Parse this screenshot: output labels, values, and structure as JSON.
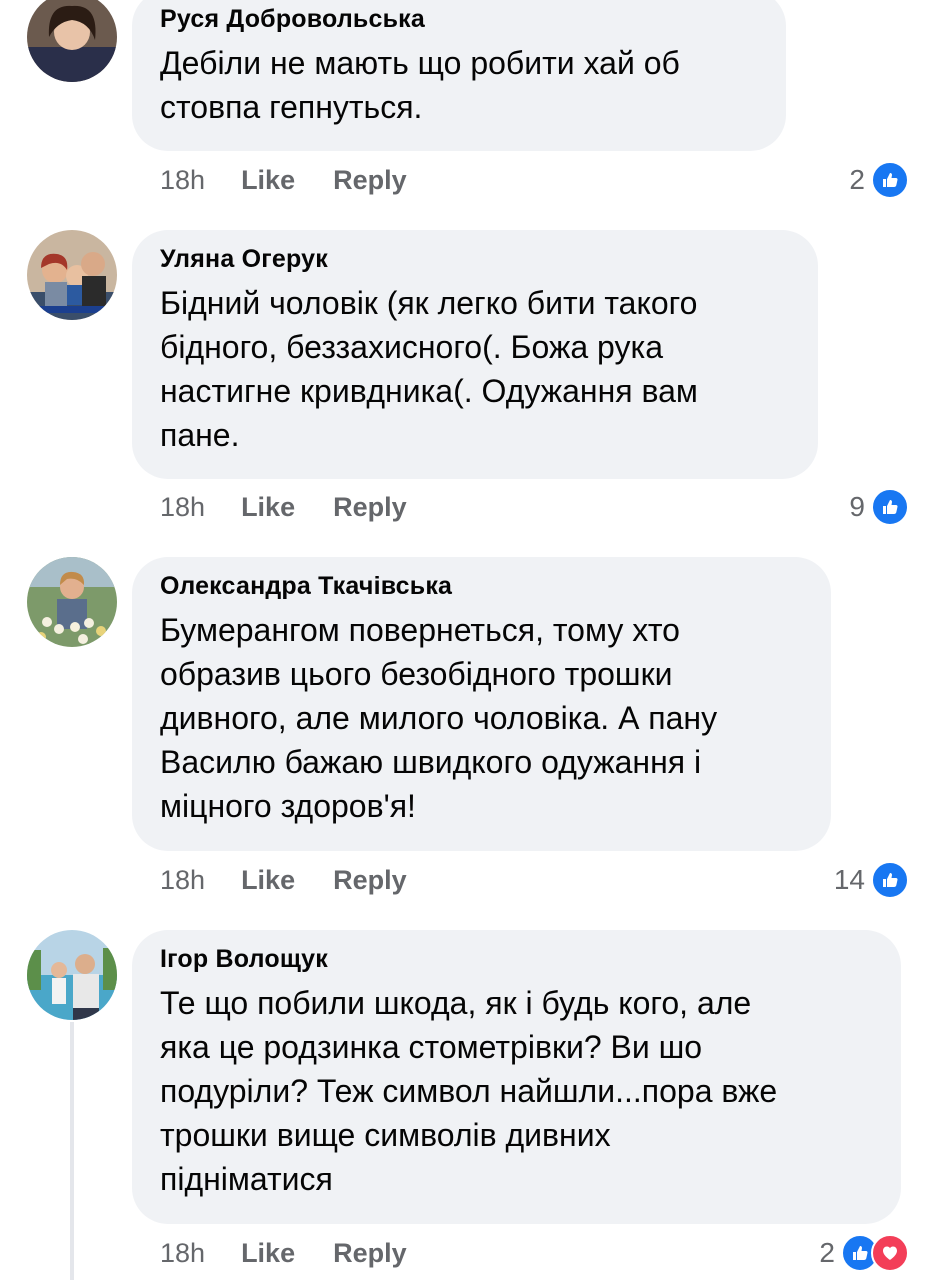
{
  "colors": {
    "bubble": "#f0f2f5",
    "meta": "#65676b",
    "like_blue": "#1877f2",
    "love_red": "#f33e58"
  },
  "comments": [
    {
      "author": "Руся Добровольська",
      "lines": [
        "Дебіли не мають що робити хай об",
        "стовпа гепнуться."
      ],
      "time": "18h",
      "like_label": "Like",
      "reply_label": "Reply",
      "reaction_count": "2",
      "reactions": [
        "like-icon"
      ]
    },
    {
      "author": "Уляна Огерук",
      "lines": [
        "Бідний чоловік (як легко бити такого",
        "бідного, беззахисного(. Божа рука",
        "настигне кривдника(. Одужання вам",
        "пане."
      ],
      "time": "18h",
      "like_label": "Like",
      "reply_label": "Reply",
      "reaction_count": "9",
      "reactions": [
        "like-icon"
      ]
    },
    {
      "author": "Олександра Ткачівська",
      "lines": [
        "Бумерангом повернеться, тому хто",
        "образив цього безобідного трошки",
        "дивного, але милого чоловіка. А пану",
        "Василю бажаю швидкого одужання і",
        "міцного здоров'я!"
      ],
      "time": "18h",
      "like_label": "Like",
      "reply_label": "Reply",
      "reaction_count": "14",
      "reactions": [
        "like-icon"
      ]
    },
    {
      "author": "Ігор Волощук",
      "lines": [
        "Те що побили шкода, як і будь кого, але",
        "яка це родзинка стометрівки? Ви шо",
        "подуріли? Теж символ найшли...пора вже",
        "трошки вище символів дивних",
        "підніматися"
      ],
      "time": "18h",
      "like_label": "Like",
      "reply_label": "Reply",
      "reaction_count": "2",
      "reactions": [
        "like-icon",
        "love-icon"
      ]
    }
  ]
}
